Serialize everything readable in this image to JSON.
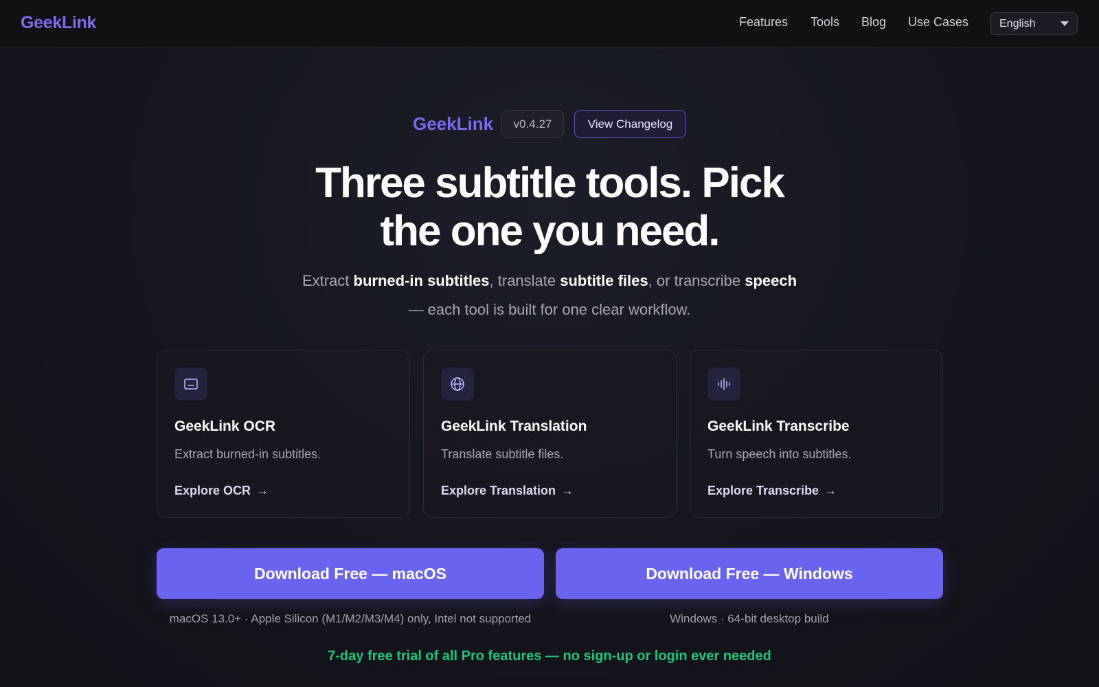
{
  "header": {
    "logo": "GeekLink",
    "nav": [
      "Features",
      "Tools",
      "Blog",
      "Use Cases"
    ],
    "language": "English"
  },
  "hero": {
    "brand": "GeekLink",
    "version": "v0.4.27",
    "changelog_label": "View Changelog",
    "headline_line1": "Three subtitle tools. Pick",
    "headline_line2": "the one you need.",
    "sub": {
      "p1": "Extract ",
      "b1": "burned-in subtitles",
      "p2": ", translate ",
      "b2": "subtitle files",
      "p3": ", or transcribe ",
      "b3": "speech",
      "p4": "— each tool is built for one clear workflow."
    }
  },
  "cards": [
    {
      "icon": "subtitle-screen-icon",
      "title": "GeekLink OCR",
      "desc": "Extract burned-in subtitles.",
      "link": "Explore OCR"
    },
    {
      "icon": "globe-icon",
      "title": "GeekLink Translation",
      "desc": "Translate subtitle files.",
      "link": "Explore Translation"
    },
    {
      "icon": "waveform-icon",
      "title": "GeekLink Transcribe",
      "desc": "Turn speech into subtitles.",
      "link": "Explore Transcribe"
    }
  ],
  "download": {
    "mac_label": "Download Free — macOS",
    "mac_note": "macOS 13.0+ · Apple Silicon (M1/M2/M3/M4) only, Intel not supported",
    "win_label": "Download Free — Windows",
    "win_note": "Windows · 64-bit desktop build"
  },
  "trial": "7-day free trial of all Pro features — no sign-up or login ever needed",
  "colors": {
    "accent": "#6a63ef",
    "brand": "#7a6af0",
    "trial": "#1fc47e",
    "background": "#14151c"
  }
}
